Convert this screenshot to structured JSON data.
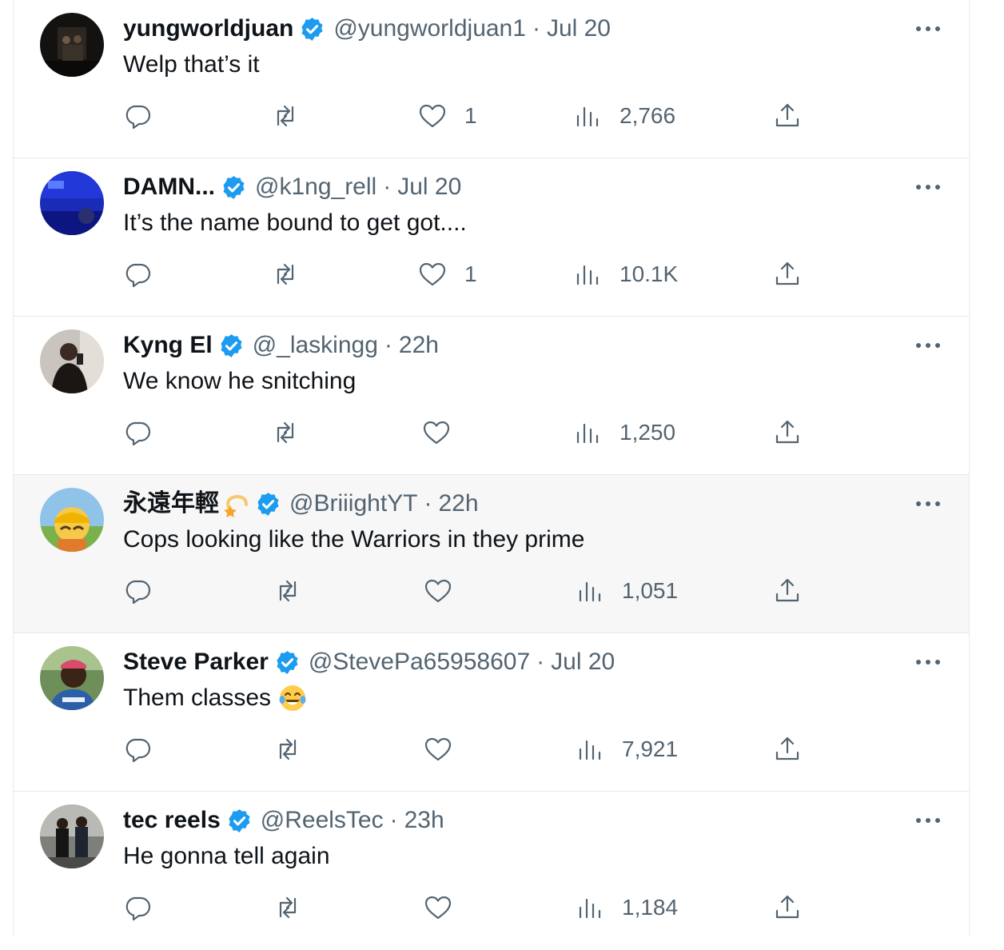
{
  "colors": {
    "verified": "#1d9bf0",
    "secondary_text": "#536471",
    "primary_text": "#0f1419",
    "divider": "#e6e9eb",
    "hover_bg": "#f7f7f7"
  },
  "tweets": [
    {
      "name": "yungworldjuan",
      "handle": "@yungworldjuan1",
      "separator": "·",
      "time": "Jul 20",
      "text": "Welp that’s it",
      "likes": "1",
      "views": "2,766",
      "verified": true
    },
    {
      "name": "DAMN...",
      "handle": "@k1ng_rell",
      "separator": "·",
      "time": "Jul 20",
      "text": "It’s the name bound to get got....",
      "likes": "1",
      "views": "10.1K",
      "verified": true
    },
    {
      "name": "Kyng El",
      "handle": "@_laskingg",
      "separator": "·",
      "time": "22h",
      "text": "We know he snitching",
      "likes": "",
      "views": "1,250",
      "verified": true
    },
    {
      "name": "永遠年輕",
      "name_emoji": "dizzy-star-emoji",
      "handle": "@BriiightYT",
      "separator": "·",
      "time": "22h",
      "text": "Cops looking like the Warriors in they prime",
      "likes": "",
      "views": "1,051",
      "verified": true
    },
    {
      "name": "Steve Parker",
      "handle": "@StevePa65958607",
      "separator": "·",
      "time": "Jul 20",
      "text": "Them classes",
      "text_emoji": "tears-of-joy-emoji",
      "likes": "",
      "views": "7,921",
      "verified": true
    },
    {
      "name": "tec reels",
      "handle": "@ReelsTec",
      "separator": "·",
      "time": "23h",
      "text": "He gonna tell again",
      "likes": "",
      "views": "1,184",
      "verified": true
    }
  ]
}
